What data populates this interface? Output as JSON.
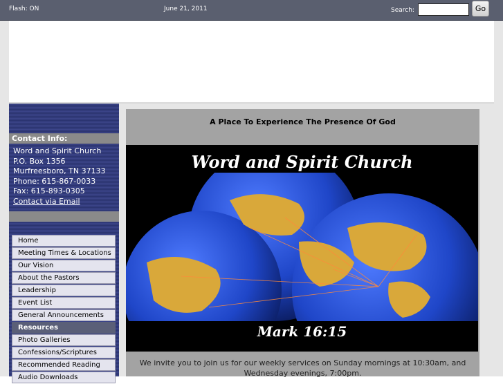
{
  "topbar": {
    "flash_status": "Flash: ON",
    "date": "June 21, 2011",
    "search_label": "Search:",
    "search_value": "",
    "go_label": "Go"
  },
  "contact": {
    "heading": "Contact Info:",
    "lines": [
      "Word and Spirit Church",
      "P.O. Box 1356",
      "Murfreesboro, TN  37133",
      "Phone: 615-867-0033",
      "Fax: 615-893-0305"
    ],
    "email_link": "Contact via Email"
  },
  "menu": {
    "items": [
      "Home",
      "Meeting Times & Locations",
      "Our Vision",
      "About the Pastors",
      "Leadership",
      "Event List",
      "General Announcements"
    ],
    "section_label": "Resources",
    "resources": [
      "Photo Galleries",
      "Confessions/Scriptures",
      "Recommended Reading",
      "Audio Downloads"
    ]
  },
  "main": {
    "tagline": "A Place To Experience The Presence Of God",
    "hero_title": "Word and Spirit Church",
    "hero_verse": "Mark 16:15",
    "invite_text": "We invite you to join us for our weekly services on Sunday mornings at 10:30am, and Wednesday evenings, 7:00pm."
  },
  "colors": {
    "topbar": "#5a5f6f",
    "sidebar": "#2b3470",
    "globe_ocean": "#1f46c8",
    "continents": "#d9a83a"
  }
}
